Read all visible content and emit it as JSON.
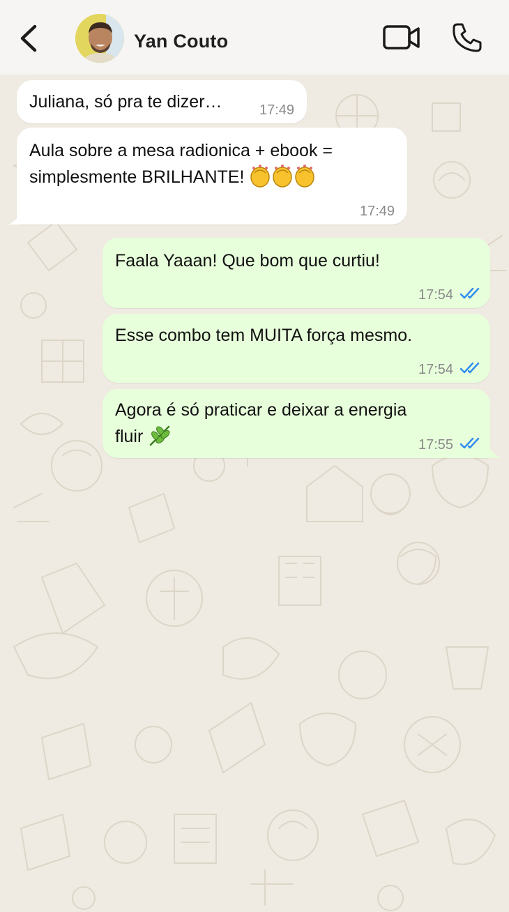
{
  "header": {
    "contact_name": "Yan Couto",
    "icons": {
      "back": "chevron-left-icon",
      "video": "video-camera-icon",
      "call": "phone-icon"
    }
  },
  "messages": [
    {
      "direction": "incoming",
      "text": "Juliana, só pra te dizer…",
      "time": "17:49"
    },
    {
      "direction": "incoming",
      "text_line1": "Aula sobre a mesa radionica + ebook =",
      "text_line2": "simplesmente BRILHANTE!",
      "emoji": "clapping-hands x3",
      "time": "17:49"
    },
    {
      "direction": "outgoing",
      "text": "Faala Yaaan! Que bom que curtiu!",
      "time": "17:54",
      "status": "read"
    },
    {
      "direction": "outgoing",
      "text": "Esse combo tem MUITA força mesmo.",
      "time": "17:54",
      "status": "read"
    },
    {
      "direction": "outgoing",
      "text_line1": "Agora é só praticar e deixar a energia",
      "text_line2": "fluir",
      "emoji": "herb",
      "time": "17:55",
      "status": "read"
    }
  ],
  "colors": {
    "header_bg": "#f6f5f3",
    "chat_bg": "#efeae2",
    "incoming_bubble": "#ffffff",
    "outgoing_bubble": "#e7ffdb",
    "read_ticks": "#2d8cf0",
    "timestamp": "#8a8a8a"
  }
}
